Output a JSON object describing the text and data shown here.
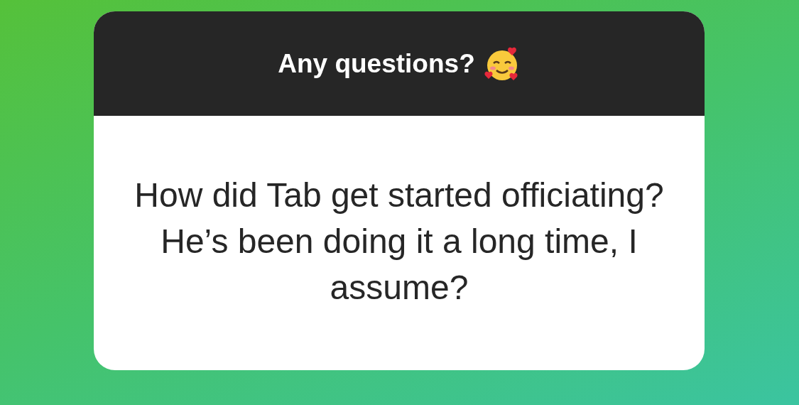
{
  "sticker": {
    "title": "Any questions?",
    "question": "How did Tab get started officiating?  He’s been doing it a long time, I assume?"
  }
}
